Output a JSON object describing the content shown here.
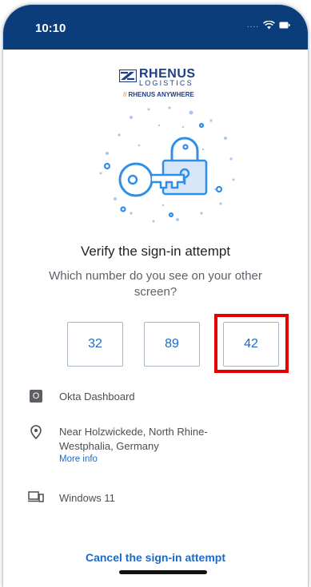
{
  "status_bar": {
    "time": "10:10",
    "signal": "....",
    "icons": [
      "wifi-icon",
      "battery-icon"
    ]
  },
  "logo": {
    "brand": "RHENUS",
    "sub": "LOGISTICS",
    "tagline": "RHENUS ANYWHERE"
  },
  "prompt": {
    "title": "Verify the sign-in attempt",
    "question": "Which number do you see on your other screen?"
  },
  "numbers": [
    "32",
    "89",
    "42"
  ],
  "details": {
    "app": "Okta Dashboard",
    "app_icon_letter": "O",
    "location": "Near Holzwickede, North Rhine-Westphalia, Germany",
    "more_info": "More info",
    "device": "Windows 11"
  },
  "cancel_label": "Cancel the sign-in attempt",
  "colors": {
    "header": "#0b3d7a",
    "accent": "#1b6ac9",
    "highlight": "#e50000"
  }
}
